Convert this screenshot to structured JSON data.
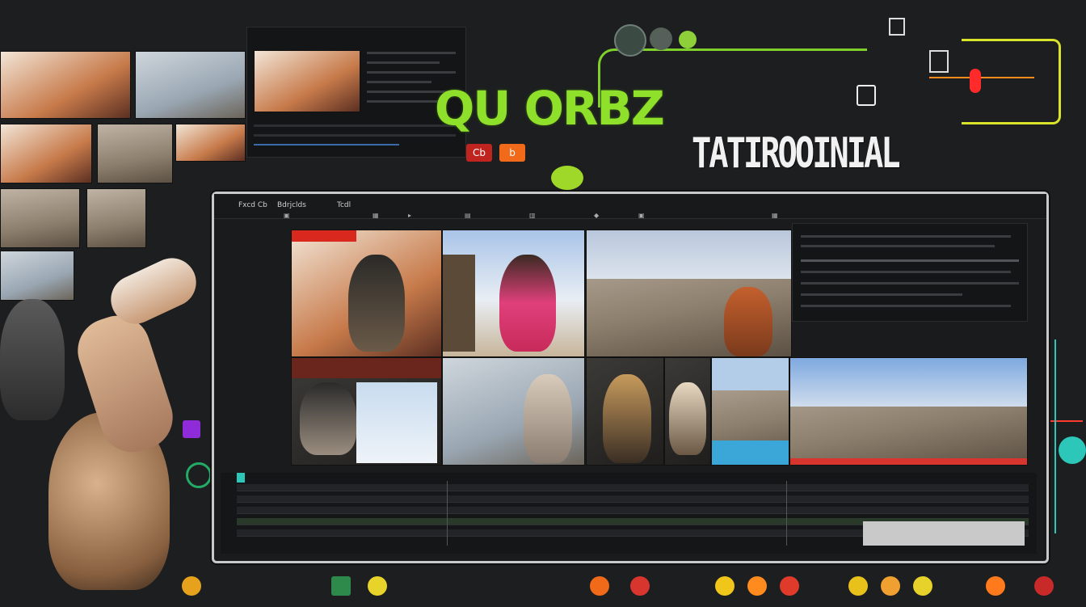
{
  "title": {
    "main": "QU ORBZ",
    "secondary": "TATIROOINIAL",
    "badges": [
      "Cb",
      "b"
    ]
  },
  "editor": {
    "menu": [
      "Fxcd Cb",
      "Bdrjclds",
      "Tcdl"
    ],
    "toolbar_icons": [
      "lock-icon",
      "grid-icon",
      "play-icon",
      "settings-icon"
    ]
  },
  "colors": {
    "accent_green": "#8fe02b",
    "wire_yellow": "#d8e32a",
    "wire_orange": "#ff8a1d",
    "wire_teal": "#2cc7b8",
    "wire_red": "#ff3b2f",
    "frame": "#c9c9c9"
  }
}
